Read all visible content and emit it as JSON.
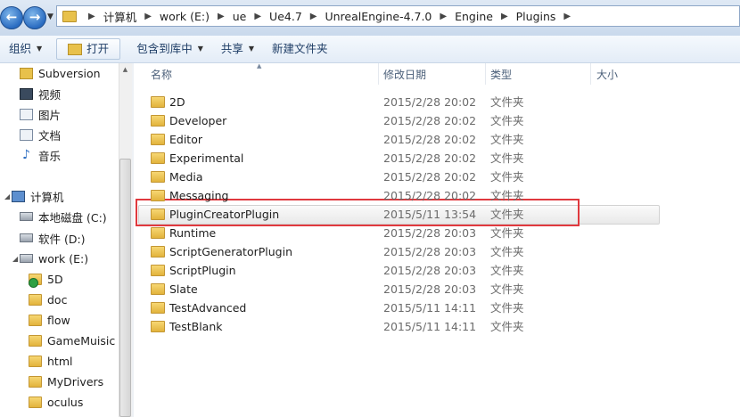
{
  "address": {
    "crumbs": [
      "计算机",
      "work (E:)",
      "ue",
      "Ue4.7",
      "UnrealEngine-4.7.0",
      "Engine",
      "Plugins"
    ]
  },
  "toolbar": {
    "organize": "组织",
    "open": "打开",
    "include_library": "包含到库中",
    "share": "共享",
    "new_folder": "新建文件夹"
  },
  "nav": {
    "items": [
      {
        "label": "Subversion",
        "icon": "subversion-icon"
      },
      {
        "label": "视频",
        "icon": "video-library-icon"
      },
      {
        "label": "图片",
        "icon": "picture-library-icon"
      },
      {
        "label": "文档",
        "icon": "document-library-icon"
      },
      {
        "label": "音乐",
        "icon": "music-library-icon"
      },
      {
        "label": "计算机",
        "icon": "computer-icon"
      },
      {
        "label": "本地磁盘 (C:)",
        "icon": "local-disk-icon"
      },
      {
        "label": "软件 (D:)",
        "icon": "drive-icon"
      },
      {
        "label": "work (E:)",
        "icon": "drive-icon"
      },
      {
        "label": "5D",
        "icon": "svn-folder-icon"
      },
      {
        "label": "doc",
        "icon": "folder-icon"
      },
      {
        "label": "flow",
        "icon": "folder-icon"
      },
      {
        "label": "GameMuisic",
        "icon": "folder-icon"
      },
      {
        "label": "html",
        "icon": "folder-icon"
      },
      {
        "label": "MyDrivers",
        "icon": "folder-icon"
      },
      {
        "label": "oculus",
        "icon": "folder-icon"
      }
    ]
  },
  "columns": {
    "name": "名称",
    "date": "修改日期",
    "type": "类型",
    "size": "大小"
  },
  "files": [
    {
      "name": "2D",
      "date": "2015/2/28 20:02",
      "type": "文件夹"
    },
    {
      "name": "Developer",
      "date": "2015/2/28 20:02",
      "type": "文件夹"
    },
    {
      "name": "Editor",
      "date": "2015/2/28 20:02",
      "type": "文件夹"
    },
    {
      "name": "Experimental",
      "date": "2015/2/28 20:02",
      "type": "文件夹"
    },
    {
      "name": "Media",
      "date": "2015/2/28 20:02",
      "type": "文件夹"
    },
    {
      "name": "Messaging",
      "date": "2015/2/28 20:02",
      "type": "文件夹"
    },
    {
      "name": "PluginCreatorPlugin",
      "date": "2015/5/11 13:54",
      "type": "文件夹"
    },
    {
      "name": "Runtime",
      "date": "2015/2/28 20:03",
      "type": "文件夹"
    },
    {
      "name": "ScriptGeneratorPlugin",
      "date": "2015/2/28 20:03",
      "type": "文件夹"
    },
    {
      "name": "ScriptPlugin",
      "date": "2015/2/28 20:03",
      "type": "文件夹"
    },
    {
      "name": "Slate",
      "date": "2015/2/28 20:03",
      "type": "文件夹"
    },
    {
      "name": "TestAdvanced",
      "date": "2015/5/11 14:11",
      "type": "文件夹"
    },
    {
      "name": "TestBlank",
      "date": "2015/5/11 14:11",
      "type": "文件夹"
    }
  ],
  "colors": {
    "highlight_box": "#e0393e",
    "folder": "#e8c14b",
    "toolbar_text": "#1e3d66"
  }
}
